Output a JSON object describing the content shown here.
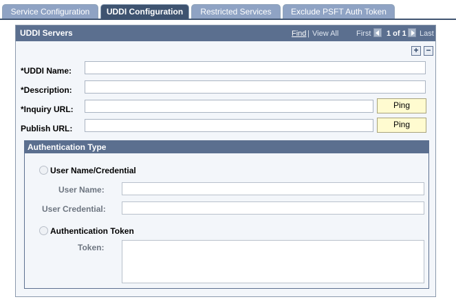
{
  "tabs": [
    {
      "label": "Service Configuration",
      "active": false
    },
    {
      "label": "UDDI Configuration",
      "active": true
    },
    {
      "label": "Restricted Services",
      "active": false
    },
    {
      "label": "Exclude PSFT Auth Token",
      "active": false
    }
  ],
  "panel": {
    "title": "UDDI Servers",
    "nav": {
      "find": "Find",
      "separator": "|",
      "view_all": "View All",
      "first": "First",
      "counter": "1 of 1",
      "last": "Last"
    },
    "add_symbol": "+",
    "remove_symbol": "−"
  },
  "form": {
    "uddi_name_label": "*UDDI Name:",
    "uddi_name_value": "",
    "description_label": "*Description:",
    "description_value": "",
    "inquiry_url_label": "*Inquiry URL:",
    "inquiry_url_value": "",
    "publish_url_label": "Publish URL:",
    "publish_url_value": "",
    "ping_label": "Ping"
  },
  "auth": {
    "title": "Authentication Type",
    "option_credential": "User Name/Credential",
    "user_name_label": "User Name:",
    "user_credential_label": "User Credential:",
    "option_token": "Authentication Token",
    "token_label": "Token:"
  },
  "colors": {
    "header_bg": "#5b6f8f",
    "active_tab": "#3e5370",
    "inactive_tab": "#8fa3c4",
    "ping_bg": "#fffbd0"
  }
}
